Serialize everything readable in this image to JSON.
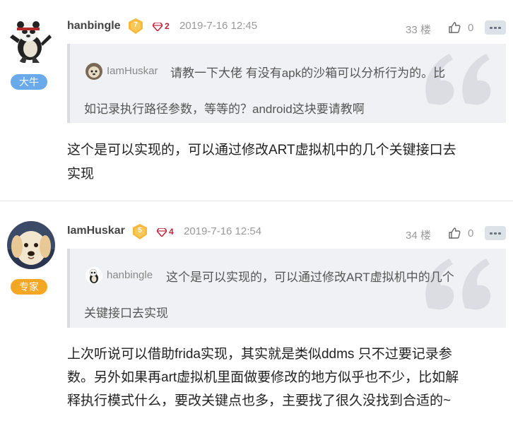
{
  "posts": [
    {
      "username": "hanbingle",
      "rank": "大牛",
      "rank_color": "#6aa9ec",
      "level": "7",
      "gems": "2",
      "date": "2019-7-16 12:45",
      "floor": "33 楼",
      "likes": "0",
      "quote": {
        "user": "IamHuskar",
        "line1": "请教一下大佬 有没有apk的沙箱可以分析行为的。比",
        "line2": "如记录执行路径参数，等等的？android这块要请教啊"
      },
      "body": {
        "line1": "这个是可以实现的，可以通过修改ART虚拟机中的几个关键接口去",
        "line2": "实现"
      }
    },
    {
      "username": "IamHuskar",
      "rank": "专家",
      "rank_color": "#f5a623",
      "level": "5",
      "gems": "4",
      "date": "2019-7-16 12:54",
      "floor": "34 楼",
      "likes": "0",
      "quote": {
        "user": "hanbingle",
        "line1": "这个是可以实现的，可以通过修改ART虚拟机中的几个",
        "line2": "关键接口去实现"
      },
      "body": {
        "line1": "上次听说可以借助frida实现，其实就是类似ddms 只不过要记录参",
        "line2": "数。另外如果再art虚拟机里面做要修改的地方似乎也不少，比如解",
        "line3": "释执行模式什么，要改关键点也多，主要找了很久没找到合适的~"
      }
    }
  ],
  "icons": {
    "level": "level-badge-icon",
    "gem": "gem-icon",
    "like": "thumbs-up-icon",
    "more": "more-icon",
    "quote": "quote-mark-icon"
  }
}
